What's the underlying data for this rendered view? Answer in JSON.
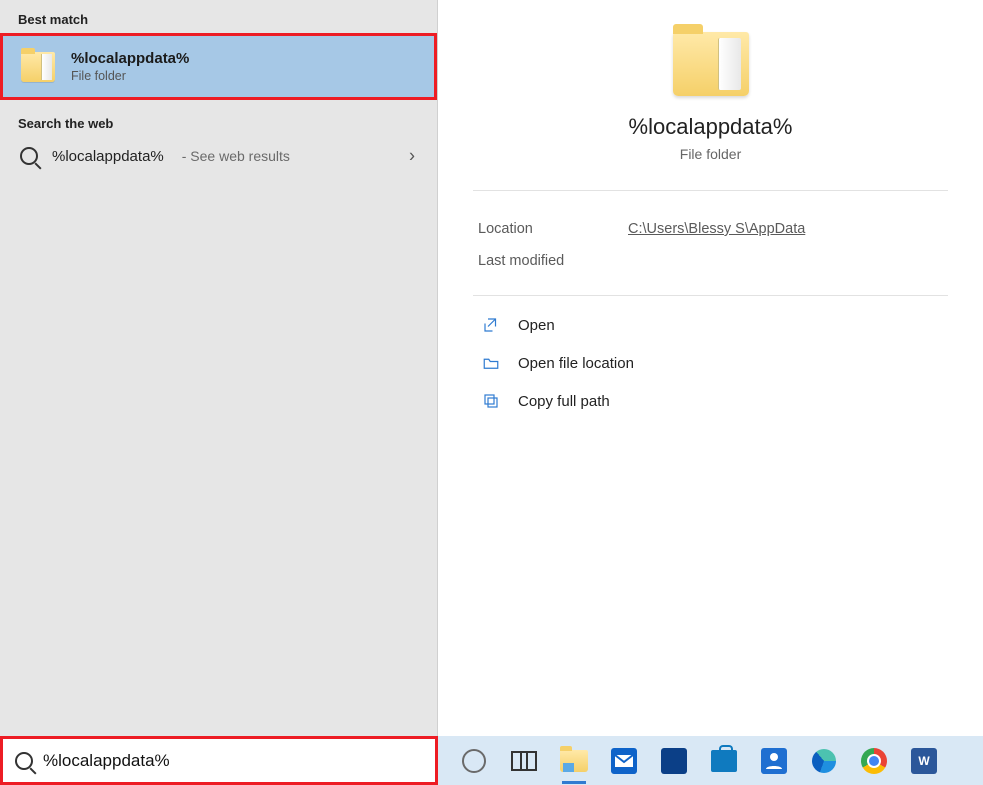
{
  "left": {
    "best_match_header": "Best match",
    "best_match": {
      "title": "%localappdata%",
      "subtitle": "File folder"
    },
    "web_header": "Search the web",
    "web_result": {
      "term": "%localappdata%",
      "hint": "- See web results",
      "chevron": "›"
    }
  },
  "preview": {
    "title": "%localappdata%",
    "subtitle": "File folder",
    "meta": {
      "location_label": "Location",
      "location_value": "C:\\Users\\Blessy S\\AppData",
      "modified_label": "Last modified",
      "modified_value": ""
    },
    "actions": {
      "open": "Open",
      "open_location": "Open file location",
      "copy_path": "Copy full path"
    }
  },
  "search": {
    "value": "%localappdata%"
  },
  "taskbar": {
    "icons": [
      "cortana",
      "task-view",
      "file-explorer",
      "mail",
      "dell",
      "store",
      "people",
      "edge",
      "chrome",
      "word"
    ]
  }
}
